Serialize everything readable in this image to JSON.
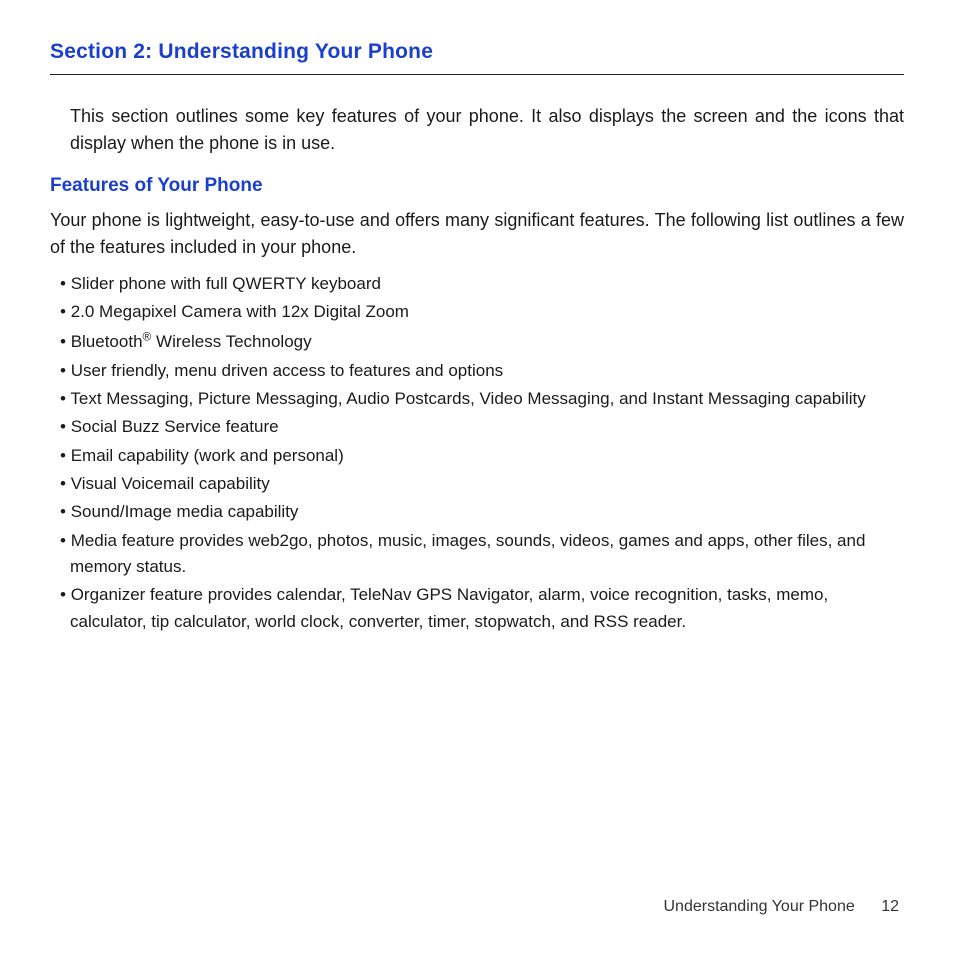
{
  "section_title": "Section 2: Understanding Your Phone",
  "intro": "This section outlines some key features of your phone. It also displays the screen and the icons that display when the phone is in use.",
  "subheading": "Features of Your Phone",
  "body_para": "Your phone is lightweight, easy-to-use and offers many significant features. The following list outlines a few of the features included in your phone.",
  "features": [
    "Slider phone with full QWERTY keyboard",
    "2.0 Megapixel Camera with 12x Digital Zoom",
    "Bluetooth® Wireless Technology",
    "User friendly, menu driven access to features and options",
    "Text Messaging, Picture Messaging, Audio Postcards, Video Messaging, and Instant Messaging capability",
    "Social Buzz Service feature",
    "Email capability (work and personal)",
    "Visual Voicemail capability",
    "Sound/Image media capability",
    "Media feature provides web2go, photos, music, images, sounds, videos, games and apps, other files, and memory status.",
    "Organizer feature provides calendar, TeleNav GPS Navigator, alarm, voice recognition, tasks, memo, calculator, tip calculator, world clock, converter, timer, stopwatch, and RSS reader."
  ],
  "footer_label": "Understanding Your Phone",
  "page_number": "12"
}
